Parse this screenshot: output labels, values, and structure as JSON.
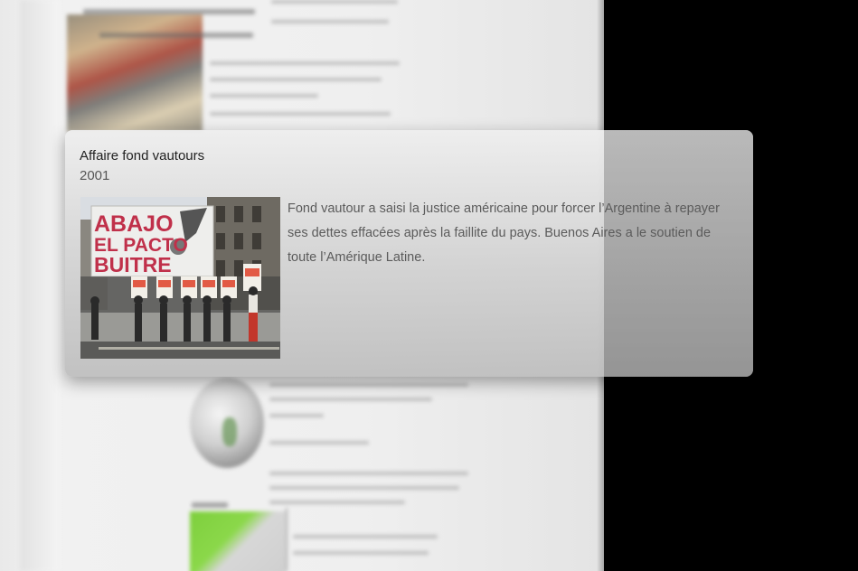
{
  "card": {
    "title": "Affaire fond vautours",
    "year": "2001",
    "description": "Fond vautour a saisi la justice américaine pour forcer l’Argentine à repayer ses dettes effacées après la faillite du pays. Buenos Aires a le soutien de toute l’Amérique Latine.",
    "photo": {
      "banner_text": [
        "ABAJO",
        "EL PACTO",
        "BUITRE"
      ]
    }
  },
  "colors": {
    "background": "#000000",
    "page": "#efefef",
    "card": "#d8d8d8",
    "banner_text": "#c0304a",
    "sign": "#e25a45"
  }
}
